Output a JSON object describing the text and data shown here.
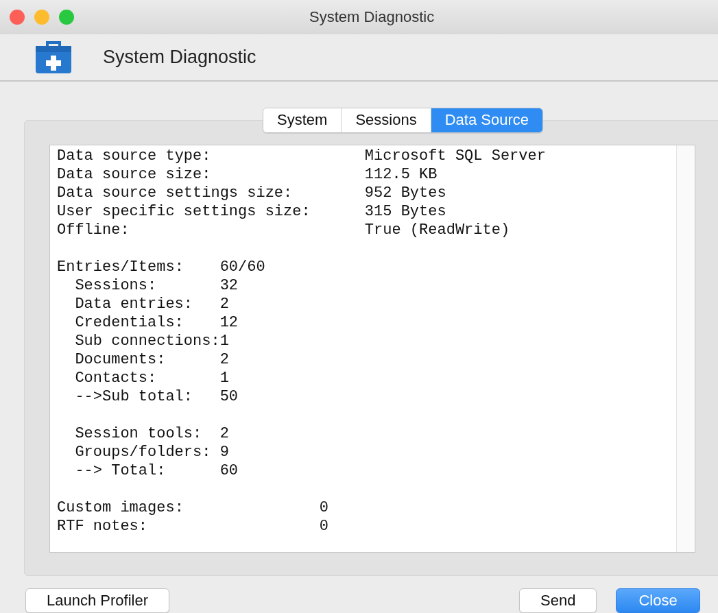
{
  "window": {
    "title": "System Diagnostic"
  },
  "header": {
    "title": "System Diagnostic"
  },
  "tabs": [
    {
      "label": "System",
      "selected": false
    },
    {
      "label": "Sessions",
      "selected": false
    },
    {
      "label": "Data Source",
      "selected": true
    }
  ],
  "report": [
    {
      "kind": "summary",
      "rows": [
        {
          "label": "Data source type:",
          "value": "Microsoft SQL Server"
        },
        {
          "label": "Data source size:",
          "value": "112.5 KB"
        },
        {
          "label": "Data source settings size:",
          "value": "952 Bytes"
        },
        {
          "label": "User specific settings size:",
          "value": "315 Bytes"
        },
        {
          "label": "Offline:",
          "value": "True (ReadWrite)"
        }
      ]
    },
    {
      "kind": "counts",
      "rows": [
        {
          "label": "Entries/Items:",
          "value": "60/60",
          "children": [
            {
              "rows": [
                {
                  "label": "Sessions:",
                  "value": "32"
                },
                {
                  "label": "Data entries:",
                  "value": "2"
                },
                {
                  "label": "Credentials:",
                  "value": "12"
                },
                {
                  "label": "Sub connections:",
                  "value": "1"
                },
                {
                  "label": "Documents:",
                  "value": "2"
                },
                {
                  "label": "Contacts:",
                  "value": "1"
                },
                {
                  "label": "-->Sub total:",
                  "value": "50"
                }
              ]
            },
            {
              "rows": [
                {
                  "label": "Session tools:",
                  "value": "2"
                },
                {
                  "label": "Groups/folders:",
                  "value": "9"
                },
                {
                  "label": "--> Total:",
                  "value": "60"
                }
              ]
            }
          ]
        }
      ]
    },
    {
      "kind": "extras",
      "rows": [
        {
          "label": "Custom images:",
          "value": "0"
        },
        {
          "label": "RTF notes:",
          "value": "0"
        }
      ]
    }
  ],
  "buttons": [
    {
      "label": "Launch Profiler",
      "kind": "plain"
    },
    {
      "label": "Send",
      "kind": "plain"
    },
    {
      "label": "Close",
      "kind": "default"
    }
  ]
}
